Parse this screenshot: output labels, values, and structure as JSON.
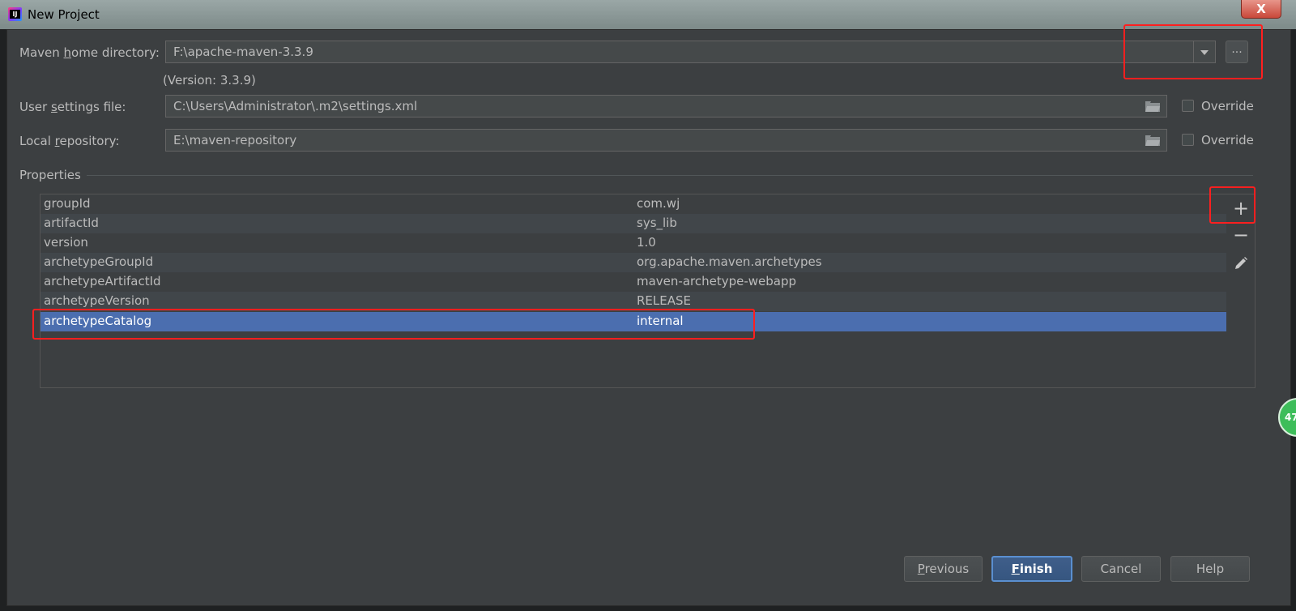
{
  "window": {
    "title": "New Project",
    "close_label": "X"
  },
  "maven": {
    "home_label_pre": "Maven ",
    "home_label_mnemonic": "h",
    "home_label_post": "ome directory:",
    "home_value": "F:\\apache-maven-3.3.9",
    "browse_label": "...",
    "version_text": "(Version: 3.3.9)",
    "settings_label_pre": "User ",
    "settings_label_mnemonic": "s",
    "settings_label_post": "ettings file:",
    "settings_value": "C:\\Users\\Administrator\\.m2\\settings.xml",
    "settings_override": "Override",
    "repo_label_pre": "Local ",
    "repo_label_mnemonic": "r",
    "repo_label_post": "epository:",
    "repo_value": "E:\\maven-repository",
    "repo_override": "Override"
  },
  "properties": {
    "section_title": "Properties",
    "rows": [
      {
        "key": "groupId",
        "value": "com.wj"
      },
      {
        "key": "artifactId",
        "value": "sys_lib"
      },
      {
        "key": "version",
        "value": "1.0"
      },
      {
        "key": "archetypeGroupId",
        "value": "org.apache.maven.archetypes"
      },
      {
        "key": "archetypeArtifactId",
        "value": "maven-archetype-webapp"
      },
      {
        "key": "archetypeVersion",
        "value": "RELEASE"
      },
      {
        "key": "archetypeCatalog",
        "value": "internal"
      }
    ],
    "selected_row": "archetypeCatalog",
    "toolbar": {
      "add_label": "+",
      "remove_label": "−"
    }
  },
  "footer": {
    "previous_mnemonic": "P",
    "previous_rest": "revious",
    "finish_mnemonic": "F",
    "finish_rest": "inish",
    "cancel": "Cancel",
    "help": "Help"
  },
  "badge_text": "47",
  "colors": {
    "selection": "#4b6eaf",
    "highlight": "#ff1f1f",
    "background": "#3c3f41"
  }
}
